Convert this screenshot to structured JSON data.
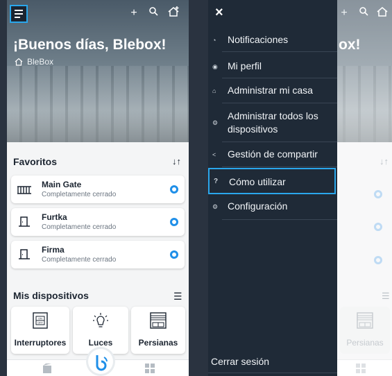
{
  "left": {
    "greeting": "¡Buenos días, Blebox!",
    "home_name": "BleBox",
    "favorites_title": "Favoritos",
    "favorites": [
      {
        "name": "Main Gate",
        "status": "Completamente cerrado"
      },
      {
        "name": "Furtka",
        "status": "Completamente cerrado"
      },
      {
        "name": "Firma",
        "status": "Completamente cerrado"
      }
    ],
    "devices_title": "Mis dispositivos",
    "categories": [
      {
        "label": "Interruptores"
      },
      {
        "label": "Luces"
      },
      {
        "label": "Persianas"
      }
    ],
    "switch_icon_on": "ON",
    "switch_icon_off": "OFF"
  },
  "right": {
    "close_glyph": "×",
    "peek_greeting": "ox!",
    "menu_items": [
      {
        "label": "Notificaciones",
        "icon": "bell-icon"
      },
      {
        "label": "Mi perfil",
        "icon": "user-icon"
      },
      {
        "label": "Administrar mi casa",
        "icon": "home-settings-icon"
      },
      {
        "label": "Administrar todos los dispositivos",
        "icon": "devices-icon"
      },
      {
        "label": "Gestión de compartir",
        "icon": "share-icon"
      },
      {
        "label": "Cómo utilizar",
        "icon": "question-icon"
      },
      {
        "label": "Configuración",
        "icon": "gear-icon"
      }
    ],
    "logout": "Cerrar sesión",
    "peek_category": "Persianas"
  },
  "colors": {
    "accent": "#2aa7ec",
    "drawer_bg": "#1f2a37",
    "ring": "#1f8fe8"
  }
}
